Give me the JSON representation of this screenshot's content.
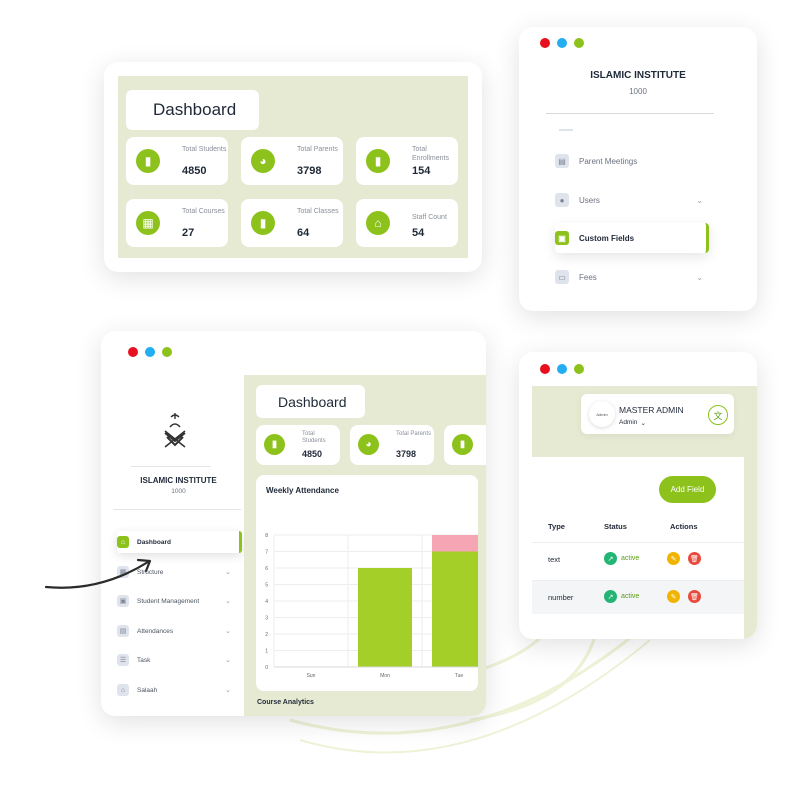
{
  "colors": {
    "accent": "#8cc21b",
    "panel_bg": "#e7ead3",
    "dot_red": "#e8101e",
    "dot_blue": "#22aef0",
    "dot_green": "#8cc21b",
    "bar": "#a4cf28",
    "bar_top": "#f6a5b5",
    "status_active": "#22b573",
    "edit": "#f0b400",
    "delete": "#ea4a3c"
  },
  "dashboard": {
    "title": "Dashboard",
    "stats": [
      {
        "label": "Total Students",
        "value": "4850",
        "icon": "bar-chart-icon"
      },
      {
        "label": "Total Parents",
        "value": "3798",
        "icon": "pie-chart-icon"
      },
      {
        "label": "Total Enrollments",
        "value": "154",
        "icon": "bar-chart-icon"
      },
      {
        "label": "Total Courses",
        "value": "27",
        "icon": "grid-icon"
      },
      {
        "label": "Total Classes",
        "value": "64",
        "icon": "bar-chart-icon"
      },
      {
        "label": "Staff Count",
        "value": "54",
        "icon": "home-icon"
      }
    ]
  },
  "institute": {
    "name": "ISLAMIC INSTITUTE",
    "code": "1000"
  },
  "menu": {
    "items": [
      {
        "label": "Parent Meetings",
        "icon": "meeting-icon",
        "chevron": ""
      },
      {
        "label": "Users",
        "icon": "user-icon",
        "chevron": "⌄"
      },
      {
        "label": "Custom Fields",
        "icon": "custom-fields-icon",
        "chevron": ""
      },
      {
        "label": "Fees",
        "icon": "money-icon",
        "chevron": "⌄"
      }
    ]
  },
  "app": {
    "sidebar": [
      {
        "label": "Dashboard",
        "icon": "home-icon",
        "chevron": ""
      },
      {
        "label": "Structure",
        "icon": "structure-icon",
        "chevron": "⌄"
      },
      {
        "label": "Student Management",
        "icon": "student-icon",
        "chevron": "⌄"
      },
      {
        "label": "Attendances",
        "icon": "calendar-icon",
        "chevron": "⌄"
      },
      {
        "label": "Task",
        "icon": "task-list-icon",
        "chevron": "⌄"
      },
      {
        "label": "Salaah",
        "icon": "mosque-icon",
        "chevron": "⌄"
      }
    ],
    "dashboard_title": "Dashboard",
    "stats": [
      {
        "label": "Total Students",
        "value": "4850"
      },
      {
        "label": "Total Parents",
        "value": "3798"
      }
    ],
    "course_analytics": "Course Analytics"
  },
  "chart_data": {
    "type": "bar",
    "title": "Weekly Attendance",
    "categories": [
      "Sun",
      "Mon",
      "Tue"
    ],
    "series": [
      {
        "values": [
          0,
          6,
          7
        ]
      },
      {
        "values": [
          0,
          0,
          1
        ]
      }
    ],
    "yticks": [
      "0",
      "1",
      "2",
      "3",
      "4",
      "5",
      "6",
      "7",
      "8"
    ],
    "ylim": [
      0,
      8
    ],
    "grid": true
  },
  "admin": {
    "name": "MASTER ADMIN",
    "role": "Admin",
    "avatar_text": "Admin"
  },
  "fields": {
    "add_button": "Add Field",
    "headers": {
      "type": "Type",
      "status": "Status",
      "actions": "Actions"
    },
    "rows": [
      {
        "type": "text",
        "status": "active"
      },
      {
        "type": "number",
        "status": "active"
      }
    ]
  }
}
